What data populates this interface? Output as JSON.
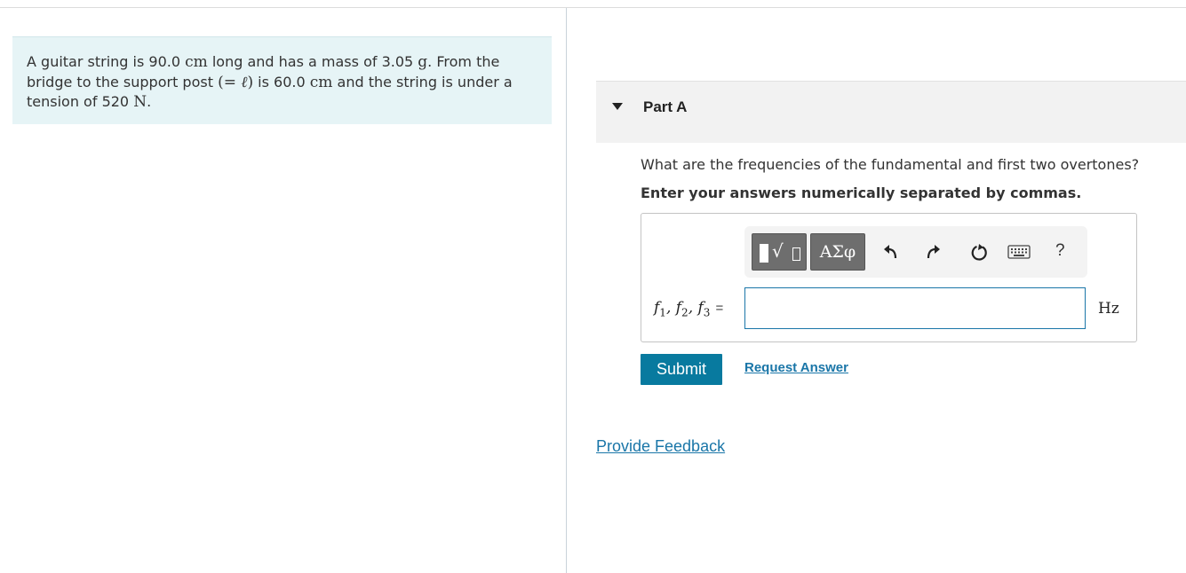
{
  "problem": {
    "p1": "A guitar string is 90.0 ",
    "u1": "cm",
    "p2": " long and has a mass of 3.05 ",
    "u2": "g",
    "p3": ". From the bridge to the support post ",
    "sym_open": "(= ",
    "sym_var": "ℓ",
    "sym_close": ")",
    "p4": " is 60.0 ",
    "u3": "cm",
    "p5": " and the string is under a tension of 520 ",
    "u4": "N",
    "p6": "."
  },
  "part": {
    "title": "Part A",
    "question": "What are the frequencies of the fundamental and first two overtones?",
    "instruction": "Enter your answers numerically separated by commas."
  },
  "toolbar": {
    "templates_icon": "radical-templates-icon",
    "greek_label": "ΑΣφ",
    "undo_icon": "undo-icon",
    "redo_icon": "redo-icon",
    "reset_icon": "reset-icon",
    "keyboard_icon": "keyboard-icon",
    "help_label": "?"
  },
  "answer": {
    "var1": "f",
    "sub1": "1",
    "var2": "f",
    "sub2": "2",
    "var3": "f",
    "sub3": "3",
    "eq": "=",
    "value": "",
    "unit": "Hz"
  },
  "actions": {
    "submit_label": "Submit",
    "request_label": "Request Answer",
    "feedback_label": "Provide Feedback"
  },
  "colors": {
    "problem_bg": "#e6f4f6",
    "accent": "#087a9f",
    "link": "#1a76a8"
  }
}
